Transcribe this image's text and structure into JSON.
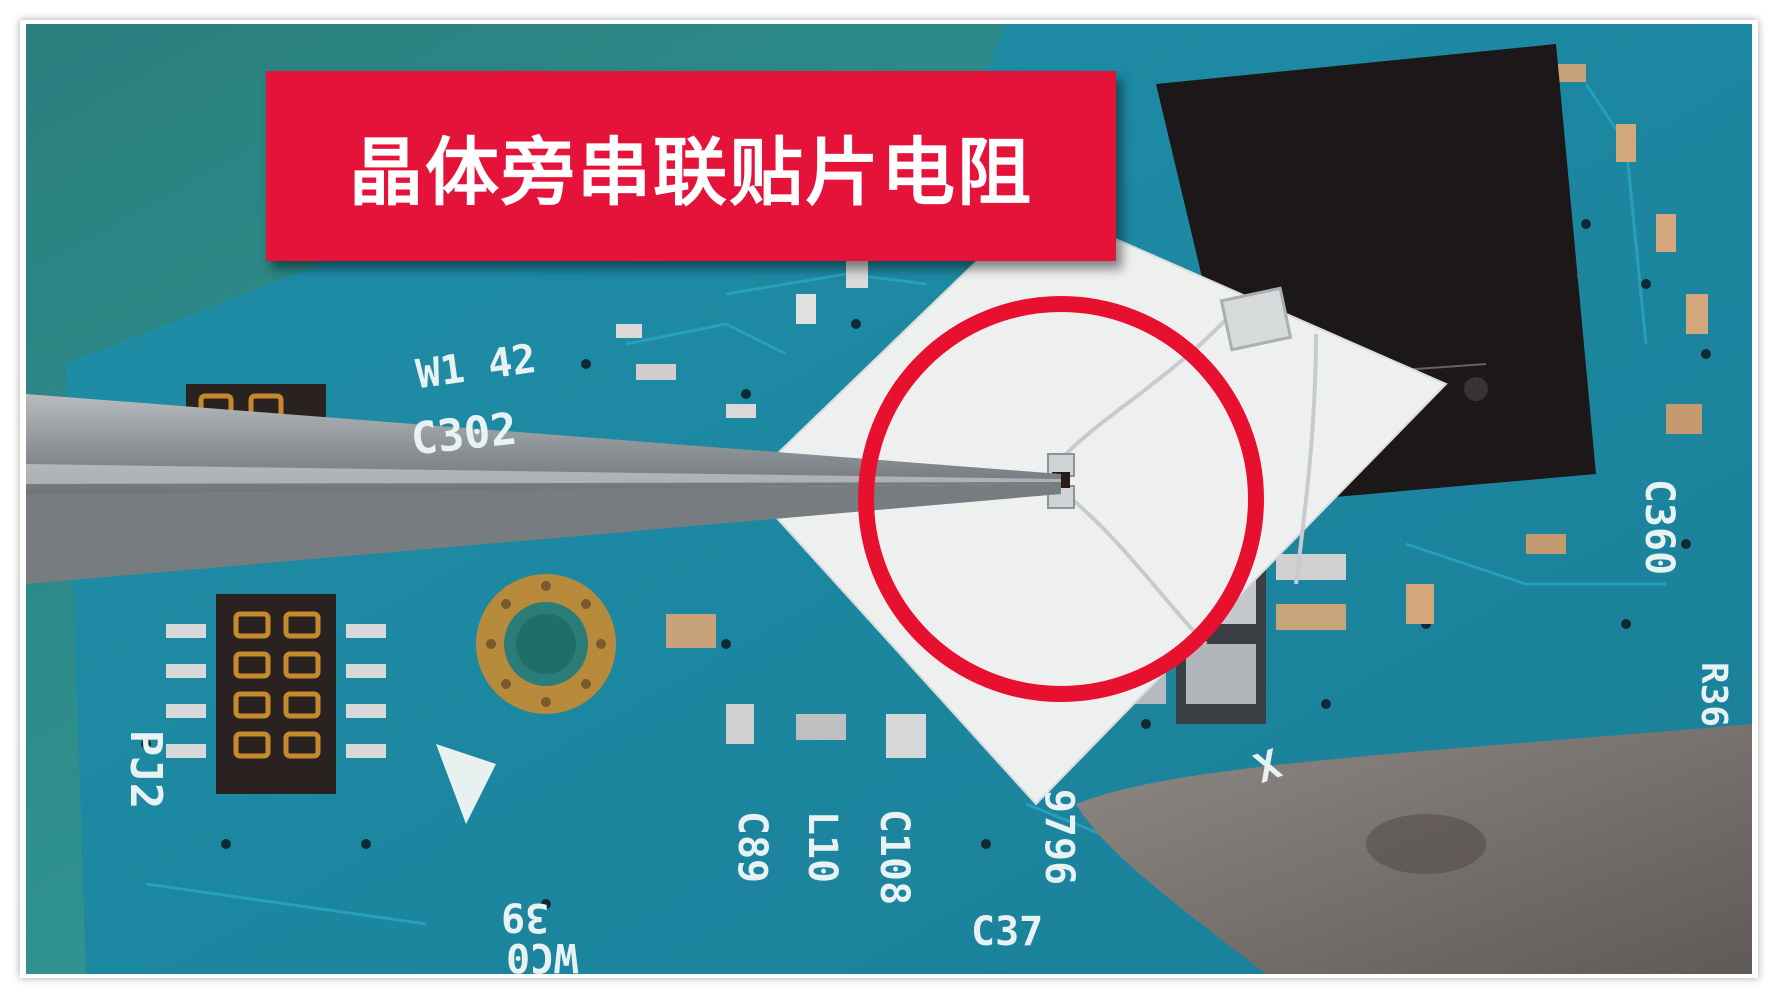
{
  "caption": {
    "text": "晶体旁串联贴片电阻",
    "background_color": "#e5123a",
    "text_color": "#ffffff"
  },
  "pcb_labels": {
    "w142": "W1 42",
    "c302": "C302",
    "c360": "C360",
    "pj2": "PJ2",
    "c89": "C89",
    "l10": "L10",
    "c108": "C108",
    "n9796": "9796",
    "c37": "C37",
    "n39": "39",
    "wc0": "WC0",
    "x": "X",
    "r36": "R36"
  },
  "colors": {
    "pcb_green": "#2f8f8c",
    "highlight_circle": "#e8102f",
    "chip_black": "#1c1718",
    "tweezers_grey": "#8e9498"
  }
}
